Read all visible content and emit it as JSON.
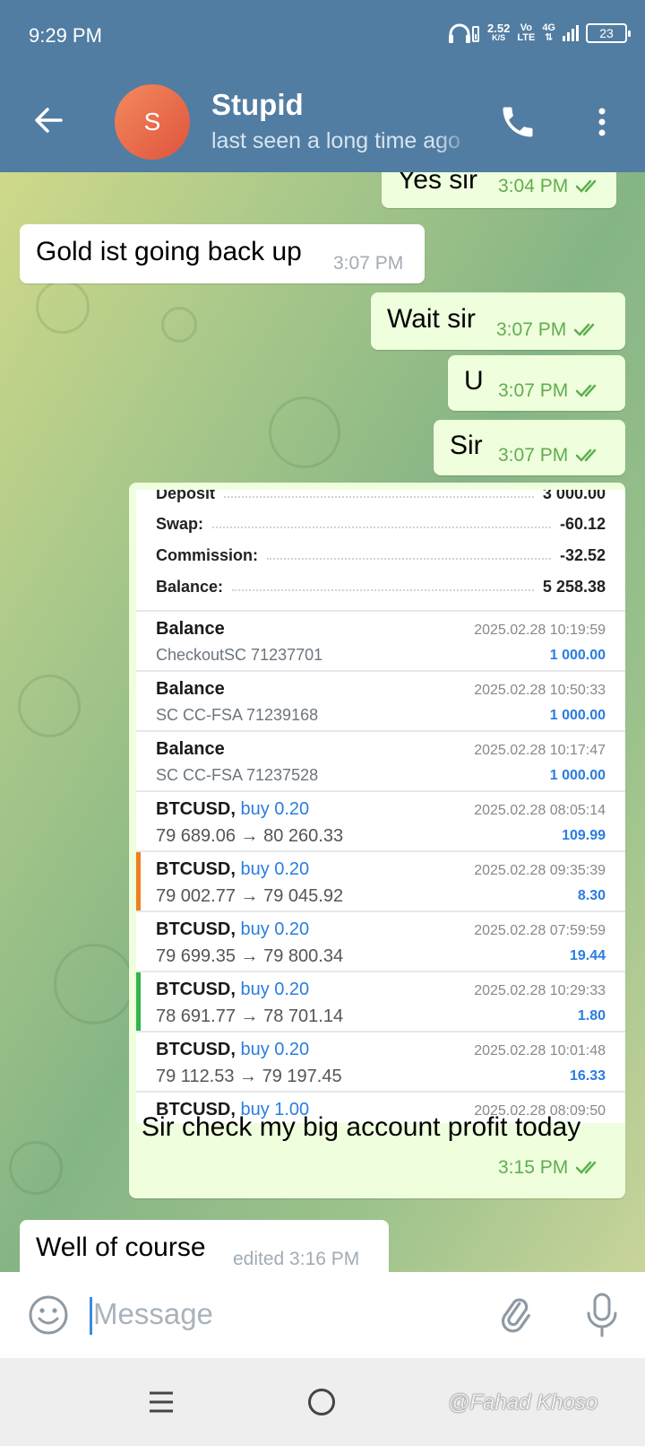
{
  "status_bar": {
    "time": "9:29 PM",
    "speed_value": "2.52",
    "speed_unit": "K/S",
    "volte_top": "Vo",
    "volte_bottom": "LTE",
    "network": "4G",
    "battery": "23"
  },
  "header": {
    "avatar_letter": "S",
    "title": "Stupid",
    "subtitle": "last seen a long time ago",
    "avatar_color": "#e8634a",
    "bar_color": "#517da2"
  },
  "messages": [
    {
      "dir": "out",
      "text": "Yes sir",
      "time": "3:04 PM"
    },
    {
      "dir": "in",
      "text": "Gold ist going back up",
      "time": "3:07 PM"
    },
    {
      "dir": "out",
      "text": "Wait sir",
      "time": "3:07 PM"
    },
    {
      "dir": "out",
      "text": "U",
      "time": "3:07 PM"
    },
    {
      "dir": "out",
      "text": "Sir",
      "time": "3:07 PM"
    },
    {
      "dir": "out",
      "text": "Sir check my big account profit today",
      "time": "3:15 PM"
    },
    {
      "dir": "in",
      "text": "Well of course",
      "time": "edited 3:16 PM"
    }
  ],
  "screenshot": {
    "summary": [
      {
        "label": "Deposit",
        "value": "3 000.00"
      },
      {
        "label": "Swap:",
        "value": "-60.12"
      },
      {
        "label": "Commission:",
        "value": "-32.52"
      },
      {
        "label": "Balance:",
        "value": "5 258.38"
      }
    ],
    "deals": [
      {
        "name": "Balance",
        "action": "",
        "sub": "CheckoutSC 71237701",
        "date": "2025.02.28 10:19:59",
        "amount": "1 000.00",
        "marker": ""
      },
      {
        "name": "Balance",
        "action": "",
        "sub": "SC CC-FSA 71239168",
        "date": "2025.02.28 10:50:33",
        "amount": "1 000.00",
        "marker": ""
      },
      {
        "name": "Balance",
        "action": "",
        "sub": "SC CC-FSA 71237528",
        "date": "2025.02.28 10:17:47",
        "amount": "1 000.00",
        "marker": ""
      },
      {
        "name": "BTCUSD,",
        "action": "buy 0.20",
        "sub": "79 689.06 → 80 260.33",
        "date": "2025.02.28 08:05:14",
        "amount": "109.99",
        "marker": ""
      },
      {
        "name": "BTCUSD,",
        "action": "buy 0.20",
        "sub": "79 002.77 → 79 045.92",
        "date": "2025.02.28 09:35:39",
        "amount": "8.30",
        "marker": "#f07d1e"
      },
      {
        "name": "BTCUSD,",
        "action": "buy 0.20",
        "sub": "79 699.35 → 79 800.34",
        "date": "2025.02.28 07:59:59",
        "amount": "19.44",
        "marker": ""
      },
      {
        "name": "BTCUSD,",
        "action": "buy 0.20",
        "sub": "78 691.77 → 78 701.14",
        "date": "2025.02.28 10:29:33",
        "amount": "1.80",
        "marker": "#2fb54a"
      },
      {
        "name": "BTCUSD,",
        "action": "buy 0.20",
        "sub": "79 112.53 → 79 197.45",
        "date": "2025.02.28 10:01:48",
        "amount": "16.33",
        "marker": ""
      },
      {
        "name": "BTCUSD,",
        "action": "buy 1.00",
        "sub": "",
        "date": "2025.02.28 08:09:50",
        "amount": "",
        "marker": ""
      }
    ]
  },
  "input": {
    "placeholder": "Message"
  },
  "watermark": "@Fahad Khoso"
}
